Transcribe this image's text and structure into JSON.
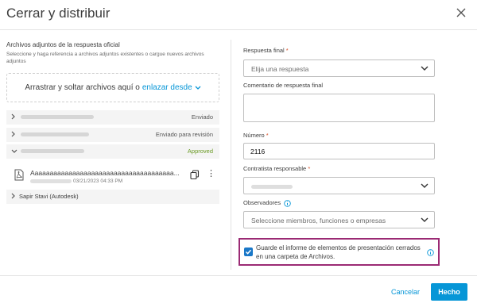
{
  "dialog": {
    "title": "Cerrar y distribuir",
    "close_icon": "close-icon"
  },
  "attachments": {
    "title": "Archivos adjuntos de la respuesta oficial",
    "subtitle": "Seleccione y haga referencia a archivos adjuntos existentes o cargue nuevos archivos adjuntos",
    "drop_text": "Arrastrar y soltar archivos aquí o",
    "link_text": "enlazar desde",
    "groups": [
      {
        "status": "Enviado"
      },
      {
        "status": "Enviado para revisión"
      },
      {
        "status": "Approved"
      }
    ],
    "file": {
      "name": "Aaaaaaaaaaaaaaaaaaaaaaaaaaaaaaaaaaaaaa...",
      "date": "03/21/2023 04:33 PM"
    },
    "person": "Sapir Stavi (Autodesk)"
  },
  "form": {
    "final_response": {
      "label": "Respuesta final",
      "required": "*",
      "placeholder": "Elija una respuesta"
    },
    "final_comment": {
      "label": "Comentario de respuesta final"
    },
    "number": {
      "label": "Número",
      "required": "*",
      "value": "2116"
    },
    "contractor": {
      "label": "Contratista responsable",
      "required": "*"
    },
    "observers": {
      "label": "Observadores",
      "placeholder": "Seleccione miembros, funciones o empresas"
    },
    "save_report": {
      "text": "Guarde el informe de elementos de presentación cerrados en una carpeta de Archivos.",
      "checked": true
    }
  },
  "footer": {
    "cancel": "Cancelar",
    "done": "Hecho"
  },
  "colors": {
    "accent": "#0696d7",
    "highlight": "#9b2a74",
    "approved": "#6a9a23",
    "required": "#d74e26"
  }
}
